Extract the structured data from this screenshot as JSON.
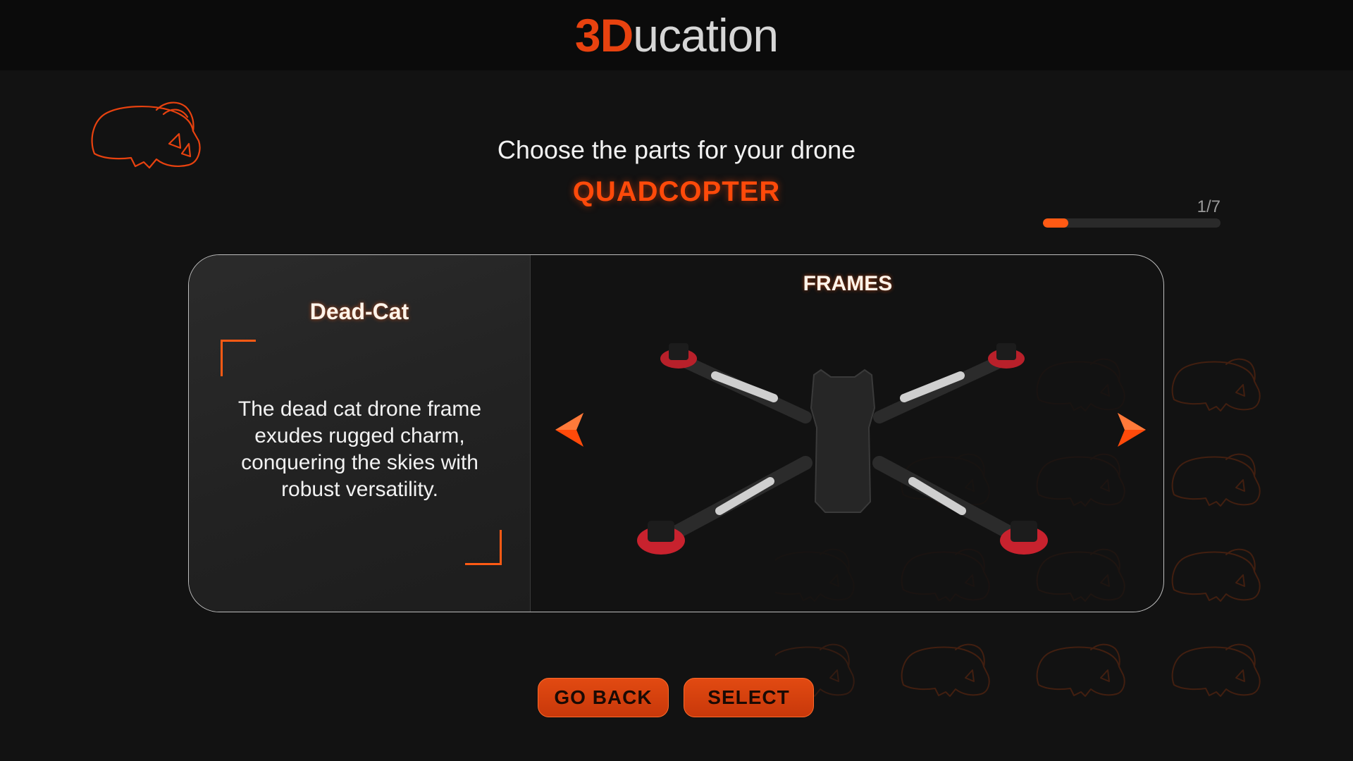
{
  "app": {
    "brand_accent": "3D",
    "brand_rest": "ucation",
    "accent_color": "#e8420f"
  },
  "header": {
    "subtitle": "Choose the parts for your drone",
    "category": "QUADCOPTER"
  },
  "progress": {
    "label": "1/7",
    "current": 1,
    "total": 7
  },
  "part": {
    "category_title": "FRAMES",
    "name": "Dead-Cat",
    "description": "The dead cat drone frame exudes rugged charm, conquering the skies with robust versatility."
  },
  "actions": {
    "back_label": "GO BACK",
    "select_label": "SELECT"
  },
  "icons": {
    "logo": "vr-headset-icon",
    "prev": "arrow-left-icon",
    "next": "arrow-right-icon",
    "pattern": "vr-headset-icon"
  }
}
